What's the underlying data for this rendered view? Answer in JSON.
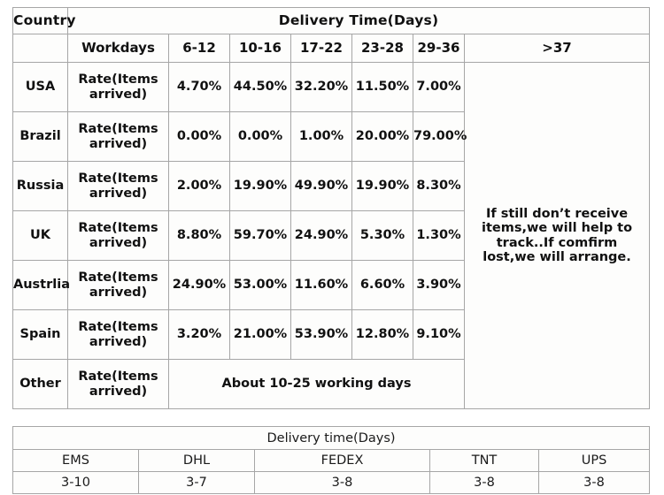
{
  "delivery_table": {
    "title_country": "Country",
    "title_delivery": "Delivery Time(Days)",
    "subheader": {
      "country": "",
      "workdays": "Workdays",
      "ranges": [
        "6-12",
        "10-16",
        "17-22",
        "23-28",
        "29-36"
      ],
      "over": ">37"
    },
    "rate_label": "Rate(Items arrived)",
    "rate_label_line1": "Rate(Items",
    "rate_label_line2": "arrived)",
    "rows": [
      {
        "country": "USA",
        "rates": [
          "4.70%",
          "44.50%",
          "32.20%",
          "11.50%",
          "7.00%"
        ]
      },
      {
        "country": "Brazil",
        "rates": [
          "0.00%",
          "0.00%",
          "1.00%",
          "20.00%",
          "79.00%"
        ]
      },
      {
        "country": "Russia",
        "rates": [
          "2.00%",
          "19.90%",
          "49.90%",
          "19.90%",
          "8.30%"
        ]
      },
      {
        "country": "UK",
        "rates": [
          "8.80%",
          "59.70%",
          "24.90%",
          "5.30%",
          "1.30%"
        ]
      },
      {
        "country": "Austrlia",
        "rates": [
          "24.90%",
          "53.00%",
          "11.60%",
          "6.60%",
          "3.90%"
        ]
      },
      {
        "country": "Spain",
        "rates": [
          "3.20%",
          "21.00%",
          "53.90%",
          "12.80%",
          "9.10%"
        ]
      }
    ],
    "other_row": {
      "country": "Other",
      "text": "About 10-25 working days"
    },
    "note": {
      "line1": "If still don’t receive",
      "line2": "items,we will help to",
      "line3": "track..If comfirm",
      "line4": "lost,we will arrange."
    }
  },
  "courier_table": {
    "title": "Delivery time(Days)",
    "carriers": [
      "EMS",
      "DHL",
      "FEDEX",
      "TNT",
      "UPS"
    ],
    "times": [
      "3-10",
      "3-7",
      "3-8",
      "3-8",
      "3-8"
    ]
  },
  "colors": {
    "border": "#a6a6a6",
    "cell_background": "#fdfdfc",
    "text": "#111111",
    "page_background": "#ffffff"
  }
}
